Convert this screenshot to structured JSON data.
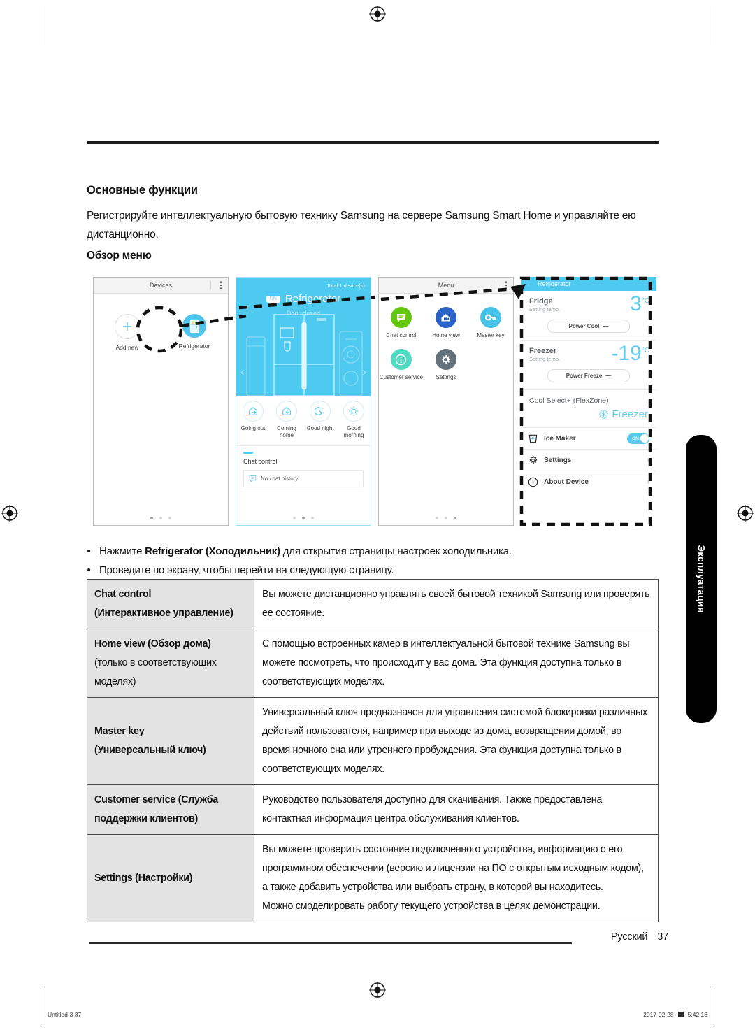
{
  "document": {
    "section_heading": "Основные функции",
    "intro_paragraph": "Регистрируйте интеллектуальную бытовую технику Samsung на сервере Samsung Smart Home и управляйте ею дистанционно.",
    "subsection_heading": "Обзор меню",
    "footer_language": "Русский",
    "footer_page": "37",
    "print_file": "Untitled-3   37",
    "print_date": "2017-02-28",
    "print_time": "5:42:16",
    "side_tab_label": "Эксплуатация"
  },
  "screens": {
    "devices": {
      "titlebar": "Devices",
      "overflow_icon": "kebab-menu-icon",
      "items": [
        {
          "label": "Add new",
          "icon": "plus-icon"
        },
        {
          "label": "Refrigerator",
          "icon": "refrigerator-icon"
        }
      ],
      "pager": {
        "count": 3,
        "active": 0
      }
    },
    "home": {
      "total_devices": "Total 1 device(s)",
      "badge": "UN",
      "device_title": "Refrigerator",
      "device_status": "Door closed",
      "prev_icon": "chevron-left-icon",
      "next_icon": "chevron-right-icon",
      "modes": [
        {
          "label": "Going out",
          "icon": "going-out-icon"
        },
        {
          "label": "Coming home",
          "icon": "coming-home-icon"
        },
        {
          "label": "Good night",
          "icon": "moon-icon"
        },
        {
          "label": "Good morning",
          "icon": "sun-icon"
        }
      ],
      "chat_heading": "Chat control",
      "chat_empty": "No chat history.",
      "pager": {
        "count": 3,
        "active": 1
      }
    },
    "menu": {
      "titlebar": "Menu",
      "overflow_icon": "kebab-menu-icon",
      "tiles": [
        {
          "label": "Chat control",
          "icon": "chat-bubble-icon",
          "color": "#63c70d"
        },
        {
          "label": "Home view",
          "icon": "home-camera-icon",
          "color": "#2b63c9"
        },
        {
          "label": "Master key",
          "icon": "key-icon",
          "color": "#46c4e8"
        },
        {
          "label": "Customer service",
          "icon": "info-icon",
          "color": "#4ddcc2"
        },
        {
          "label": "Settings",
          "icon": "gear-icon",
          "color": "#64737b"
        }
      ],
      "pager": {
        "count": 3,
        "active": 2
      }
    },
    "refrigerator": {
      "titlebar": "Refrigerator",
      "back_icon": "arrow-left-icon",
      "fridge": {
        "name": "Fridge",
        "setting_label": "Setting temp.",
        "temperature": "3",
        "unit": "°C",
        "button": "Power Cool",
        "button_state": "—"
      },
      "freezer": {
        "name": "Freezer",
        "setting_label": "Setting temp.",
        "temperature": "-19",
        "unit": "°C",
        "button": "Power Freeze",
        "button_state": "—"
      },
      "flexzone": {
        "title": "Cool Select+ (FlexZone)",
        "value": "Freezer",
        "icon": "snowflake-icon"
      },
      "rows": [
        {
          "label": "Ice Maker",
          "icon": "ice-maker-icon",
          "toggle": "ON"
        },
        {
          "label": "Settings",
          "icon": "gear-icon",
          "chevron": "›"
        },
        {
          "label": "About Device",
          "icon": "info-icon",
          "chevron": "›"
        }
      ]
    }
  },
  "bullets": [
    {
      "pre": "Нажмите ",
      "bold": "Refrigerator (Холодильник)",
      "post": " для открытия страницы настроек холодильника."
    },
    {
      "pre": "Проведите по экрану, чтобы перейти на следующую страницу.",
      "bold": "",
      "post": ""
    }
  ],
  "feature_table": {
    "rows": [
      {
        "key_bold": "Chat control",
        "key_rest": "(Интерактивное управление)",
        "paragraphs": [
          "Вы можете дистанционно управлять своей бытовой техникой Samsung или проверять ее состояние."
        ]
      },
      {
        "key_bold": "Home view (Обзор дома)",
        "key_rest": "(только в соответствующих моделях)",
        "paragraphs": [
          "С помощью встроенных камер в интеллектуальной бытовой технике Samsung вы можете посмотреть, что происходит у вас дома. Эта функция доступна только в соответствующих моделях."
        ]
      },
      {
        "key_bold": "Master key",
        "key_rest": "(Универсальный ключ)",
        "paragraphs": [
          "Универсальный ключ предназначен для управления системой блокировки различных действий пользователя, например при выходе из дома, возвращении домой, во время ночного сна или утреннего пробуждения. Эта функция доступна только в соответствующих моделях."
        ]
      },
      {
        "key_bold": "Customer service (Служба поддержки клиентов)",
        "key_rest": "",
        "paragraphs": [
          "Руководство пользователя доступно для скачивания. Также предоставлена контактная информация центра обслуживания клиентов."
        ]
      },
      {
        "key_bold": "Settings (Настройки)",
        "key_rest": "",
        "paragraphs": [
          "Вы можете проверить состояние подключенного устройства, информацию о его программном обеспечении (версию и лицензии на ПО с открытым исходным кодом), а также добавить устройства или выбрать страну, в которой вы находитесь.",
          "Можно смоделировать работу текущего устройства в целях демонстрации."
        ]
      }
    ]
  },
  "colors": {
    "accent_cyan": "#4ec9f0",
    "table_key_bg": "#e3e3e3",
    "rule_black": "#1a1a1a"
  }
}
